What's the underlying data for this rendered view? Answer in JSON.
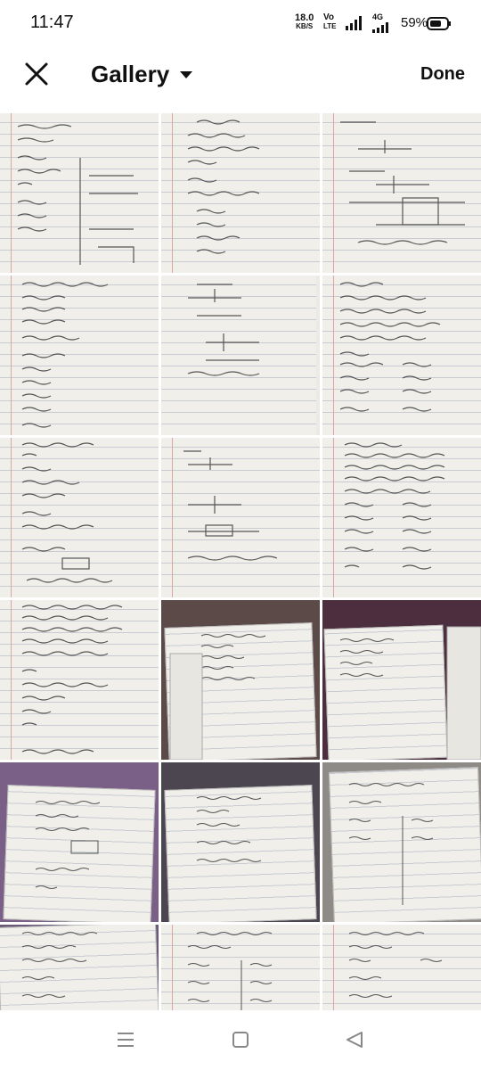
{
  "status": {
    "time": "11:47",
    "net_speed_value": "18.0",
    "net_speed_unit": "KB/S",
    "volte_top": "Vo",
    "volte_bottom": "LTE",
    "network_type": "4G",
    "battery": "59%"
  },
  "app_bar": {
    "title": "Gallery",
    "done_label": "Done"
  },
  "icons": {
    "close": "close-icon",
    "dropdown": "caret-down-icon",
    "nav_recents": "recents-icon",
    "nav_home": "home-icon",
    "nav_back": "back-icon"
  },
  "thumbnails_count_visible": 18
}
